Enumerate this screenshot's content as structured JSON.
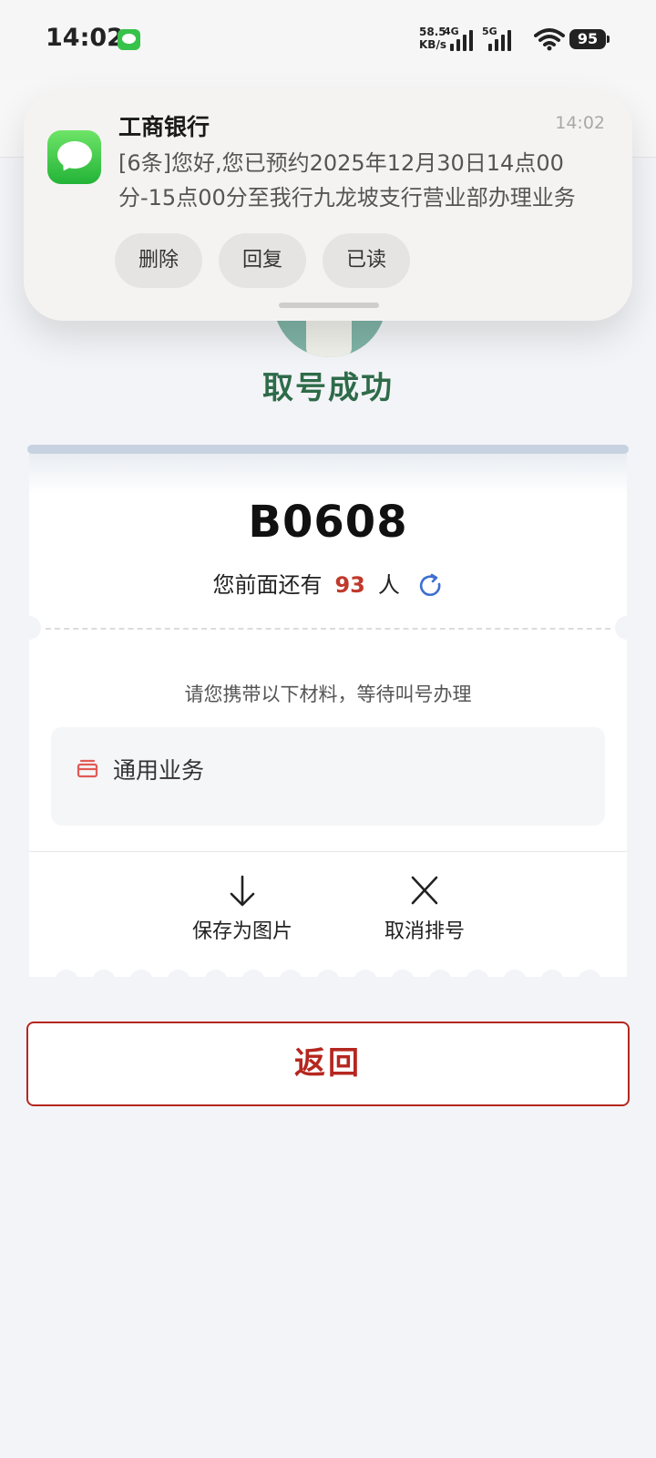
{
  "status_bar": {
    "time": "14:02",
    "net_speed_value": "58.5",
    "net_speed_unit": "KB/s",
    "sim1_label": "4G",
    "sim2_label": "5G",
    "battery": "95"
  },
  "page": {
    "title": "取号成功",
    "ticket_number": "B0608",
    "queue_prefix": "您前面还有",
    "queue_count": "93",
    "queue_suffix": "人",
    "instruction": "请您携带以下材料，等待叫号办理",
    "service_label": "通用业务",
    "actions": [
      {
        "label": "保存为图片",
        "icon": "download-icon"
      },
      {
        "label": "取消排号",
        "icon": "close-icon"
      }
    ],
    "back_button": "返回"
  },
  "notification": {
    "sender": "工商银行",
    "time": "14:02",
    "body": "[6条]您好,您已预约2025年12月30日14点00分-15点00分至我行九龙坡支行营业部办理业务",
    "buttons": [
      "删除",
      "回复",
      "已读"
    ]
  },
  "colors": {
    "accent_red": "#b5271f",
    "success_green": "#2e6b49",
    "queue_red": "#c0392b"
  }
}
